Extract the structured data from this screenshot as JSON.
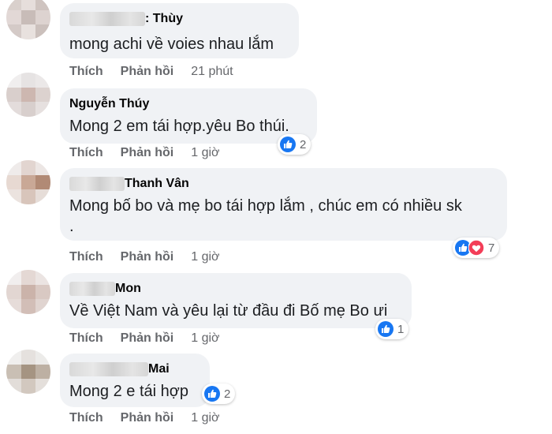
{
  "labels": {
    "like": "Thích",
    "reply": "Phản hồi"
  },
  "colors": {
    "bubble": "#f0f2f5",
    "meta": "#65676b",
    "like_blue": "#1877f2",
    "love_red": "#f33e58"
  },
  "comments": [
    {
      "name": ": Thùy",
      "text": "mong achi về voies nhau lắm",
      "time": "21 phút",
      "reactions": ""
    },
    {
      "name": "Nguyễn Thúy",
      "text": "Mong 2 em tái hợp.yêu Bo thúi.",
      "time": "1 giờ",
      "reactions": "2",
      "reaction_icons": [
        "like-icon"
      ]
    },
    {
      "name": "Thanh Vân",
      "text": "Mong bố bo và mẹ bo tái hợp lắm , chúc em có nhiều sk\n.",
      "time": "1 giờ",
      "reactions": "7",
      "reaction_icons": [
        "like-icon",
        "love-icon"
      ]
    },
    {
      "name": "Mon",
      "text": "Về Việt Nam và yêu lại từ đầu đi Bố mẹ Bo ưi",
      "time": "1 giờ",
      "reactions": "1",
      "reaction_icons": [
        "like-icon"
      ]
    },
    {
      "name": "Mai",
      "text": "Mong 2 e tái hợp",
      "time": "1 giờ",
      "reactions": "2",
      "reaction_icons": [
        "like-icon"
      ]
    }
  ]
}
